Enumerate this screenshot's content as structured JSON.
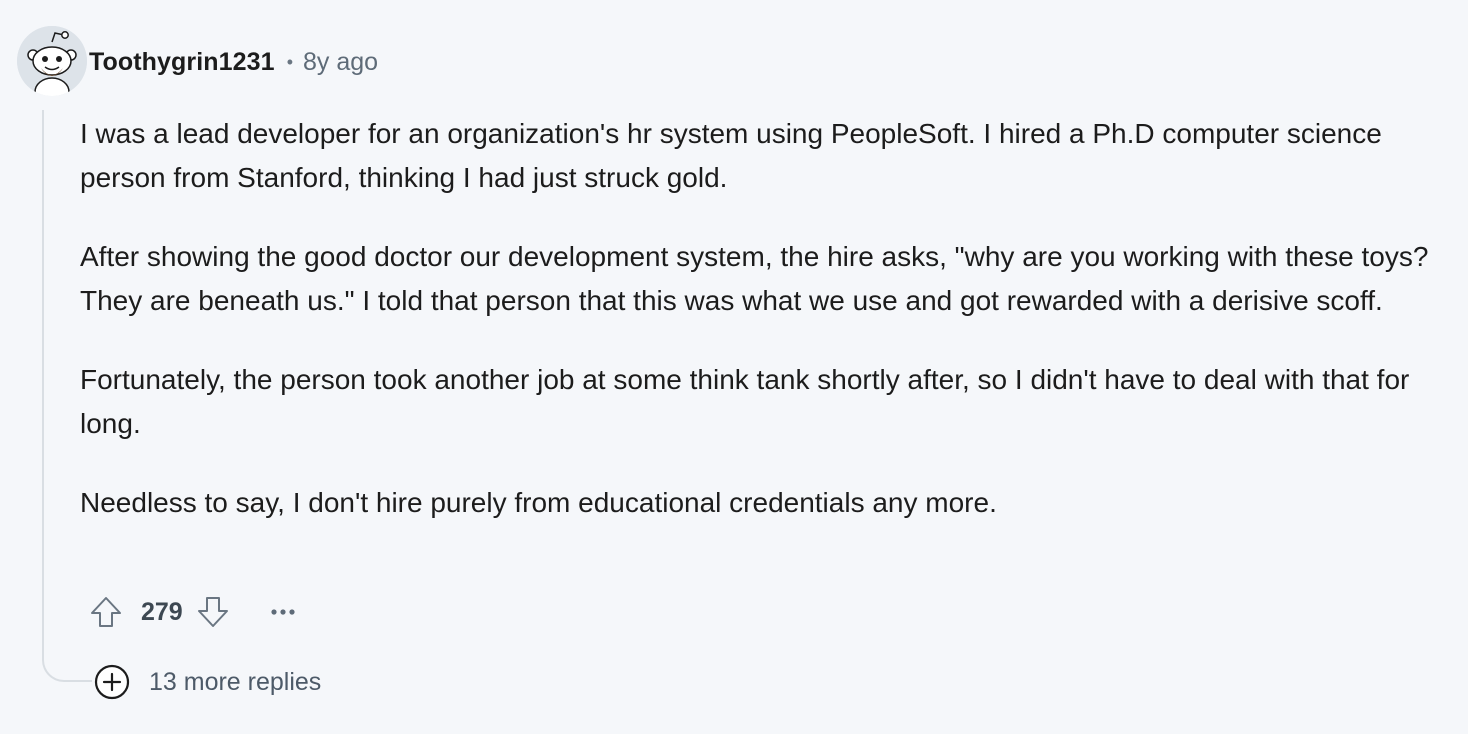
{
  "comment": {
    "author": "Toothygrin1231",
    "separator": "•",
    "timestamp": "8y ago",
    "paragraphs": [
      "I was a lead developer for an organization's hr system using PeopleSoft. I hired a Ph.D computer science person from Stanford, thinking I had just struck gold.",
      "After showing the good doctor our development system, the hire asks, \"why are you working with these toys? They are beneath us.\" I told that person that this was what we use and got rewarded with a derisive scoff.",
      "Fortunately, the person took another job at some think tank shortly after, so I didn't have to deal with that for long.",
      "Needless to say, I don't hire purely from educational credentials any more."
    ],
    "score": "279",
    "more_replies_label": "13 more replies"
  },
  "icons": {
    "avatar": "reddit-snoo-avatar",
    "upvote": "arrow-up-icon",
    "downvote": "arrow-down-icon",
    "overflow": "ellipsis-icon",
    "expand": "plus-circle-icon"
  },
  "colors": {
    "background": "#f5f7fa",
    "text": "#1c1c1c",
    "muted": "#5e6b78",
    "thread_line": "#d9dee3"
  }
}
